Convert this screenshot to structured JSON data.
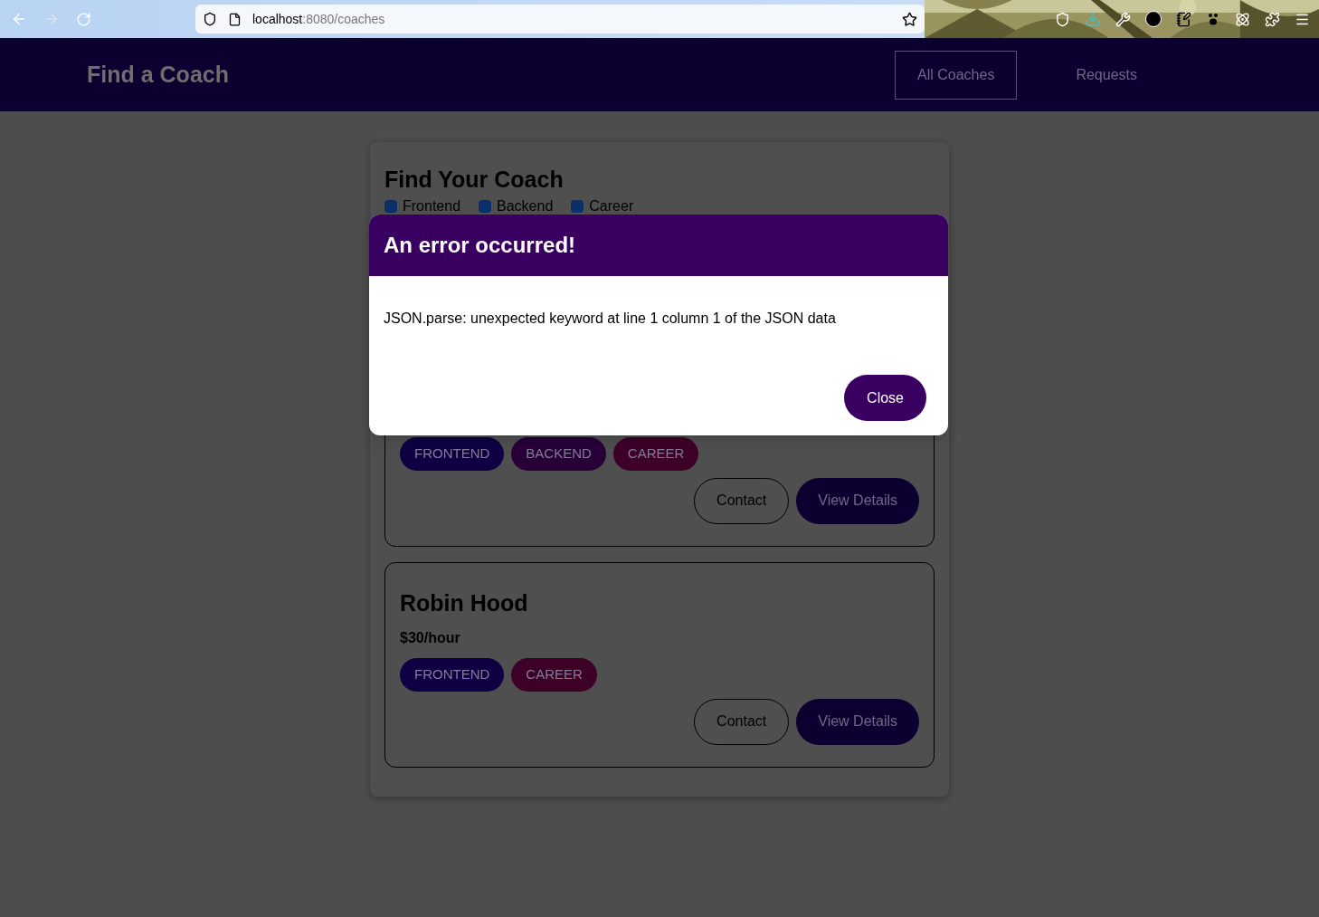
{
  "browser": {
    "url_host": "localhost",
    "url_path": ":8080/coaches"
  },
  "header": {
    "title": "Find a Coach",
    "nav": [
      {
        "label": "All Coaches",
        "selected": true
      },
      {
        "label": "Requests",
        "selected": false
      }
    ]
  },
  "filter": {
    "title": "Find Your Coach",
    "options": [
      {
        "label": "Frontend",
        "checked": true
      },
      {
        "label": "Backend",
        "checked": true
      },
      {
        "label": "Career",
        "checked": true
      }
    ]
  },
  "coaches": [
    {
      "areas": [
        {
          "label": "FRONTEND",
          "kind": "frontend"
        },
        {
          "label": "BACKEND",
          "kind": "backend"
        },
        {
          "label": "CAREER",
          "kind": "career"
        }
      ],
      "actions": [
        "Contact",
        "View Details"
      ]
    },
    {
      "name": "Robin Hood",
      "rate": "$30/hour",
      "areas": [
        {
          "label": "FRONTEND",
          "kind": "frontend"
        },
        {
          "label": "CAREER",
          "kind": "career"
        }
      ],
      "actions": [
        "Contact",
        "View Details"
      ]
    }
  ],
  "dialog": {
    "title": "An error occurred!",
    "message": "JSON.parse: unexpected keyword at line 1 column 1 of the JSON data",
    "button": "Close"
  }
}
